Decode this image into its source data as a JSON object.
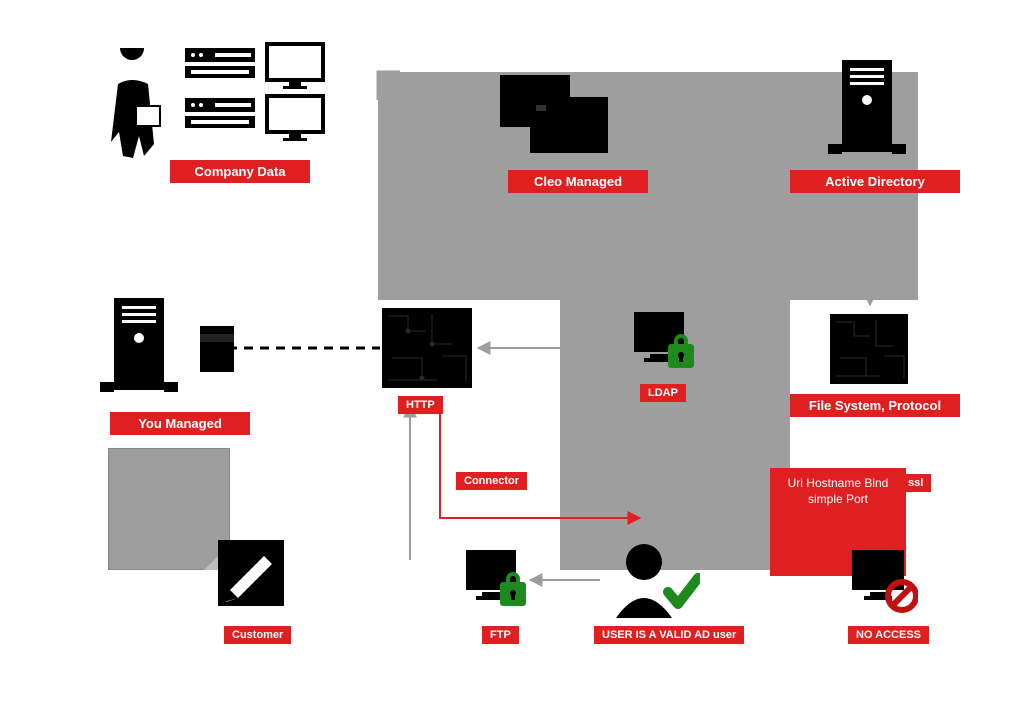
{
  "diagram": {
    "type": "architecture-flow",
    "nodes": {
      "company_data": {
        "label": "Company Data",
        "contains": [
          "person-with-papers",
          "network-servers",
          "monitors"
        ]
      },
      "cleo_managed": {
        "label": "Cleo Managed",
        "contains": [
          "stacked-servers"
        ]
      },
      "active_directory": {
        "label": "Active Directory",
        "contains": [
          "server-tower"
        ]
      },
      "you_managed": {
        "label": "You Managed",
        "contains": [
          "server-tower",
          "magnetic-stripe-card"
        ]
      },
      "http": {
        "label": "HTTP",
        "contains": [
          "circuit-panel"
        ]
      },
      "ldap": {
        "label": "LDAP",
        "contains": [
          "computer-with-lock"
        ]
      },
      "file_system_protocol": {
        "label": "File System, Protocol",
        "contains": [
          "circuit-panel-large"
        ]
      },
      "customer": {
        "label": "Customer",
        "contains": [
          "pencil-sticky-note"
        ]
      },
      "ftp": {
        "label": "FTP",
        "contains": [
          "computer-with-lock"
        ]
      },
      "validation_step": {
        "label": "USER IS A VALID AD user",
        "contains": [
          "user-with-check"
        ]
      },
      "uri_hostname": {
        "label": "Uri Hostname Bind simple Port"
      },
      "ssl": {
        "label": "ssl"
      },
      "no_access": {
        "label": "NO ACCESS",
        "contains": [
          "computer-with-prohibition"
        ]
      },
      "connector": {
        "label": "Connector"
      }
    },
    "edges": [
      {
        "from": "cleo_managed",
        "to": "active_directory",
        "style": "grey-arrow"
      },
      {
        "from": "active_directory",
        "to": "file_system_protocol",
        "style": "grey-arrow"
      },
      {
        "from": "you_managed",
        "to": "http",
        "style": "dashed-black"
      },
      {
        "from": "http",
        "to": "connector",
        "label": "Connector",
        "style": "red-arrow"
      },
      {
        "from": "connector",
        "to": "validation_step",
        "style": "red-arrow"
      },
      {
        "from": "validation_step",
        "to": "ftp",
        "style": "grey-arrow"
      },
      {
        "from": "customer_area",
        "to": "http",
        "style": "grey-arrow"
      },
      {
        "from": "ldap",
        "to": "http",
        "style": "grey-arrow"
      },
      {
        "from": "uri_hostname",
        "to": "no_access",
        "style": "adjacent"
      }
    ],
    "regions": {
      "cloud_grey_backdrop": "large grey region behind cleo/AD/LDAP/file-system nodes",
      "uri_red_box": "big red box bottom-right with Uri/Hostname/Bind/simple/Port text and ssl side label"
    }
  }
}
